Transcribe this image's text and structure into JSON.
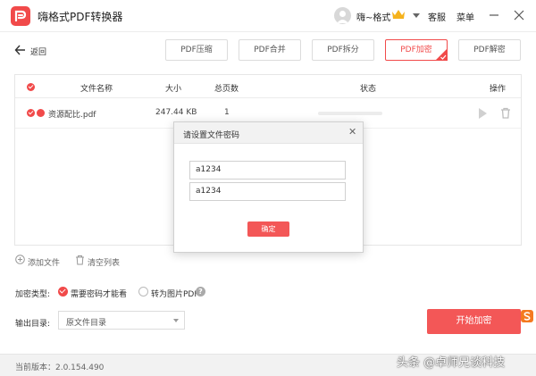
{
  "app": {
    "title": "嗨格式PDF转换器",
    "user_name": "嗨~格式",
    "service_label": "客服",
    "menu_label": "菜单",
    "brand_color": "#f14a4a"
  },
  "nav": {
    "back_label": "返回"
  },
  "tabs": [
    {
      "label": "PDF压缩",
      "active": false
    },
    {
      "label": "PDF合并",
      "active": false
    },
    {
      "label": "PDF拆分",
      "active": false
    },
    {
      "label": "PDF加密",
      "active": true
    },
    {
      "label": "PDF解密",
      "active": false
    }
  ],
  "table": {
    "headers": {
      "name": "文件名称",
      "size": "大小",
      "pages": "总页数",
      "status": "状态",
      "actions": "操作"
    },
    "rows": [
      {
        "name": "资源配比.pdf",
        "size": "247.44 KB",
        "pages": "1"
      }
    ]
  },
  "file_actions": {
    "add_label": "添加文件",
    "clear_label": "清空列表"
  },
  "options": {
    "enc_type_label": "加密类型:",
    "opt_password": "需要密码才能看",
    "opt_image": "转为图片PDF",
    "output_label": "输出目录:",
    "output_value": "原文件目录"
  },
  "start_button": "开始加密",
  "status": {
    "version": "当前版本：2.0.154.490"
  },
  "watermark": "头条 @卓师兄谈科技",
  "dialog": {
    "title": "请设置文件密码",
    "password": "a1234",
    "confirm_password": "a1234",
    "ok_label": "确定"
  }
}
